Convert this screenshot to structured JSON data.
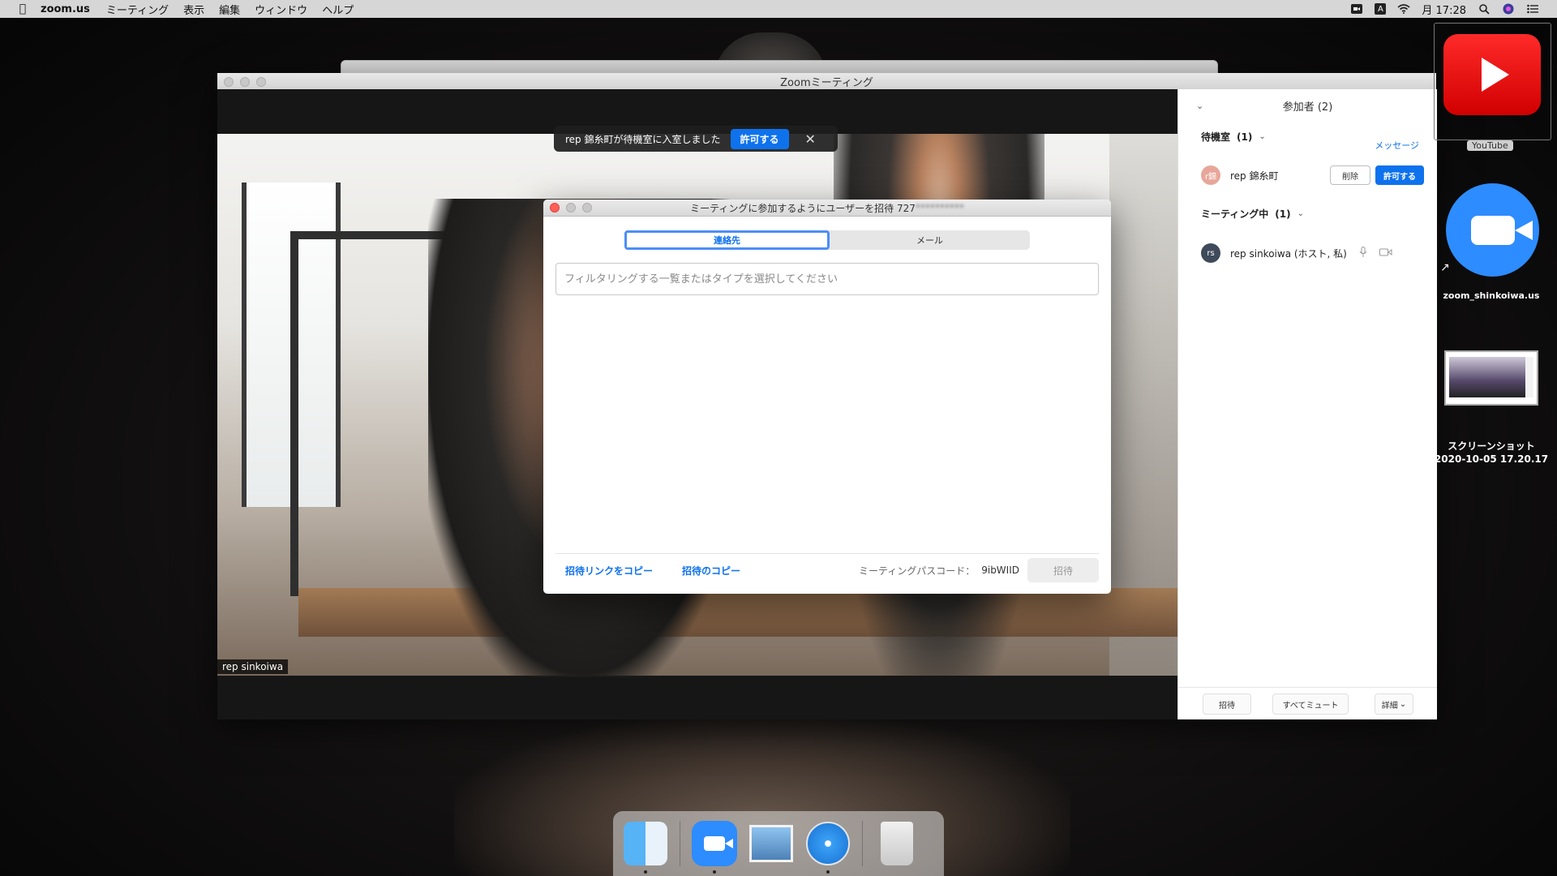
{
  "menubar": {
    "app_name": "zoom.us",
    "menus": [
      "ミーティング",
      "表示",
      "編集",
      "ウィンドウ",
      "ヘルプ"
    ],
    "status_box": "A",
    "clock": "月 17:28"
  },
  "window": {
    "title": "Zoomミーティング"
  },
  "video": {
    "name_tag": "rep sinkoiwa"
  },
  "toast": {
    "message": "rep 錦糸町が待機室に入室しました",
    "admit_label": "許可する",
    "close_symbol": "✕"
  },
  "dialog": {
    "title": "ミーティングに参加するようにユーザーを招待 727",
    "title_blurred": "**********",
    "tabs": [
      "連絡先",
      "メール"
    ],
    "active_tab": 0,
    "filter_placeholder": "フィルタリングする一覧またはタイプを選択してください",
    "copy_link_label": "招待リンクをコピー",
    "copy_invite_label": "招待のコピー",
    "passcode_label": "ミーティングパスコード：",
    "passcode_value": "9ibWIID",
    "invite_button": "招待"
  },
  "participants": {
    "header": "参加者 (2)",
    "waiting_title": "待機室",
    "waiting_count": "(1)",
    "message_link": "メッセージ",
    "waiting_user": {
      "avatar": "r錦",
      "name": "rep 錦糸町",
      "remove_label": "削除",
      "admit_label": "許可する"
    },
    "in_meeting_title": "ミーティング中",
    "in_meeting_count": "(1)",
    "host": {
      "avatar": "rs",
      "name": "rep sinkoiwa (ホスト, 私)"
    },
    "footer": {
      "invite": "招待",
      "mute_all": "すべてミュート",
      "more": "詳細"
    }
  },
  "desktop": {
    "youtube_label": "YouTube",
    "zoom_label": "zoom_shinkoiwa.us",
    "screenshot_label_line1": "スクリーンショット",
    "screenshot_label_line2": "2020-10-05 17.20.17"
  },
  "colors": {
    "accent": "#0e72ed",
    "zoom_blue": "#2d8cff",
    "youtube_red": "#ff0000"
  }
}
